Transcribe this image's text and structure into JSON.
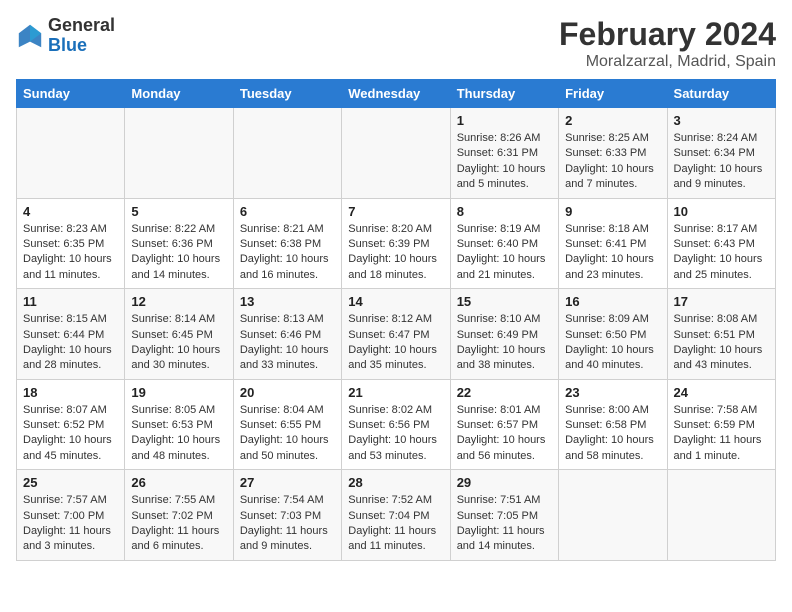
{
  "header": {
    "logo_general": "General",
    "logo_blue": "Blue",
    "title": "February 2024",
    "subtitle": "Moralzarzal, Madrid, Spain"
  },
  "calendar": {
    "days_of_week": [
      "Sunday",
      "Monday",
      "Tuesday",
      "Wednesday",
      "Thursday",
      "Friday",
      "Saturday"
    ],
    "weeks": [
      [
        {
          "day": "",
          "info": ""
        },
        {
          "day": "",
          "info": ""
        },
        {
          "day": "",
          "info": ""
        },
        {
          "day": "",
          "info": ""
        },
        {
          "day": "1",
          "info": "Sunrise: 8:26 AM\nSunset: 6:31 PM\nDaylight: 10 hours and 5 minutes."
        },
        {
          "day": "2",
          "info": "Sunrise: 8:25 AM\nSunset: 6:33 PM\nDaylight: 10 hours and 7 minutes."
        },
        {
          "day": "3",
          "info": "Sunrise: 8:24 AM\nSunset: 6:34 PM\nDaylight: 10 hours and 9 minutes."
        }
      ],
      [
        {
          "day": "4",
          "info": "Sunrise: 8:23 AM\nSunset: 6:35 PM\nDaylight: 10 hours and 11 minutes."
        },
        {
          "day": "5",
          "info": "Sunrise: 8:22 AM\nSunset: 6:36 PM\nDaylight: 10 hours and 14 minutes."
        },
        {
          "day": "6",
          "info": "Sunrise: 8:21 AM\nSunset: 6:38 PM\nDaylight: 10 hours and 16 minutes."
        },
        {
          "day": "7",
          "info": "Sunrise: 8:20 AM\nSunset: 6:39 PM\nDaylight: 10 hours and 18 minutes."
        },
        {
          "day": "8",
          "info": "Sunrise: 8:19 AM\nSunset: 6:40 PM\nDaylight: 10 hours and 21 minutes."
        },
        {
          "day": "9",
          "info": "Sunrise: 8:18 AM\nSunset: 6:41 PM\nDaylight: 10 hours and 23 minutes."
        },
        {
          "day": "10",
          "info": "Sunrise: 8:17 AM\nSunset: 6:43 PM\nDaylight: 10 hours and 25 minutes."
        }
      ],
      [
        {
          "day": "11",
          "info": "Sunrise: 8:15 AM\nSunset: 6:44 PM\nDaylight: 10 hours and 28 minutes."
        },
        {
          "day": "12",
          "info": "Sunrise: 8:14 AM\nSunset: 6:45 PM\nDaylight: 10 hours and 30 minutes."
        },
        {
          "day": "13",
          "info": "Sunrise: 8:13 AM\nSunset: 6:46 PM\nDaylight: 10 hours and 33 minutes."
        },
        {
          "day": "14",
          "info": "Sunrise: 8:12 AM\nSunset: 6:47 PM\nDaylight: 10 hours and 35 minutes."
        },
        {
          "day": "15",
          "info": "Sunrise: 8:10 AM\nSunset: 6:49 PM\nDaylight: 10 hours and 38 minutes."
        },
        {
          "day": "16",
          "info": "Sunrise: 8:09 AM\nSunset: 6:50 PM\nDaylight: 10 hours and 40 minutes."
        },
        {
          "day": "17",
          "info": "Sunrise: 8:08 AM\nSunset: 6:51 PM\nDaylight: 10 hours and 43 minutes."
        }
      ],
      [
        {
          "day": "18",
          "info": "Sunrise: 8:07 AM\nSunset: 6:52 PM\nDaylight: 10 hours and 45 minutes."
        },
        {
          "day": "19",
          "info": "Sunrise: 8:05 AM\nSunset: 6:53 PM\nDaylight: 10 hours and 48 minutes."
        },
        {
          "day": "20",
          "info": "Sunrise: 8:04 AM\nSunset: 6:55 PM\nDaylight: 10 hours and 50 minutes."
        },
        {
          "day": "21",
          "info": "Sunrise: 8:02 AM\nSunset: 6:56 PM\nDaylight: 10 hours and 53 minutes."
        },
        {
          "day": "22",
          "info": "Sunrise: 8:01 AM\nSunset: 6:57 PM\nDaylight: 10 hours and 56 minutes."
        },
        {
          "day": "23",
          "info": "Sunrise: 8:00 AM\nSunset: 6:58 PM\nDaylight: 10 hours and 58 minutes."
        },
        {
          "day": "24",
          "info": "Sunrise: 7:58 AM\nSunset: 6:59 PM\nDaylight: 11 hours and 1 minute."
        }
      ],
      [
        {
          "day": "25",
          "info": "Sunrise: 7:57 AM\nSunset: 7:00 PM\nDaylight: 11 hours and 3 minutes."
        },
        {
          "day": "26",
          "info": "Sunrise: 7:55 AM\nSunset: 7:02 PM\nDaylight: 11 hours and 6 minutes."
        },
        {
          "day": "27",
          "info": "Sunrise: 7:54 AM\nSunset: 7:03 PM\nDaylight: 11 hours and 9 minutes."
        },
        {
          "day": "28",
          "info": "Sunrise: 7:52 AM\nSunset: 7:04 PM\nDaylight: 11 hours and 11 minutes."
        },
        {
          "day": "29",
          "info": "Sunrise: 7:51 AM\nSunset: 7:05 PM\nDaylight: 11 hours and 14 minutes."
        },
        {
          "day": "",
          "info": ""
        },
        {
          "day": "",
          "info": ""
        }
      ]
    ]
  }
}
